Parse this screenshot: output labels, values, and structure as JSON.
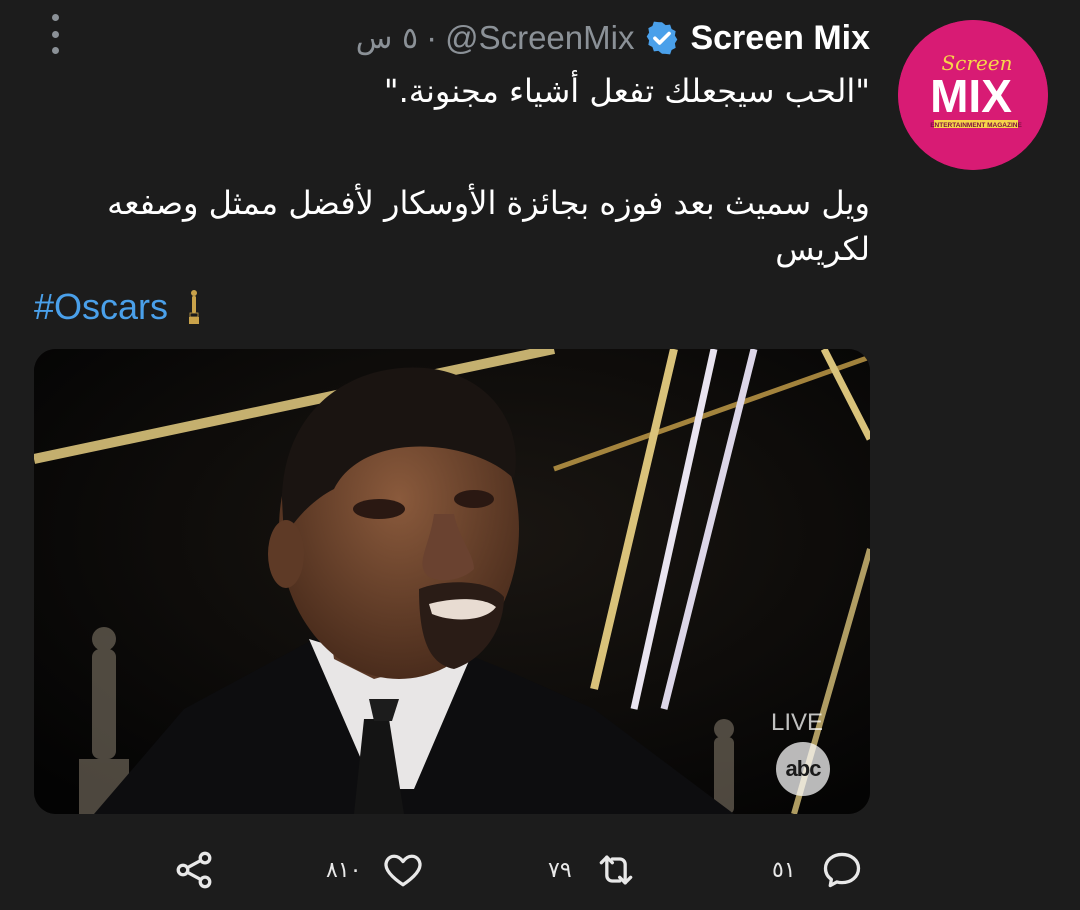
{
  "tweet": {
    "author_name": "Screen Mix",
    "handle": "@ScreenMix",
    "separator": "·",
    "time": "٥ س",
    "line1": "\"الحب سيجعلك تفعل أشياء مجنونة.\"",
    "line2": "ويل سميث بعد فوزه بجائزة الأوسكار لأفضل ممثل وصفعه",
    "line3": "لكريس",
    "hashtag": "#Oscars"
  },
  "avatar": {
    "logo_script": "Screen",
    "logo_main": "MIX",
    "logo_sub": "ENTERTAINMENT MAGAZINE"
  },
  "media": {
    "live_label": "LIVE",
    "network_logo": "abc"
  },
  "actions": {
    "replies": "٥١",
    "retweets": "٧٩",
    "likes": "٨١٠"
  },
  "icons": {
    "verified": "verified-badge-icon",
    "more": "more-vertical-icon",
    "reply": "reply-icon",
    "retweet": "retweet-icon",
    "like": "heart-icon",
    "share": "share-icon",
    "oscar": "oscar-statuette-icon"
  },
  "colors": {
    "background": "#1c1c1c",
    "secondary_text": "#8b9197",
    "link": "#4aa0ea",
    "verified": "#4aa0ea",
    "avatar_brand": "#d81b74"
  }
}
